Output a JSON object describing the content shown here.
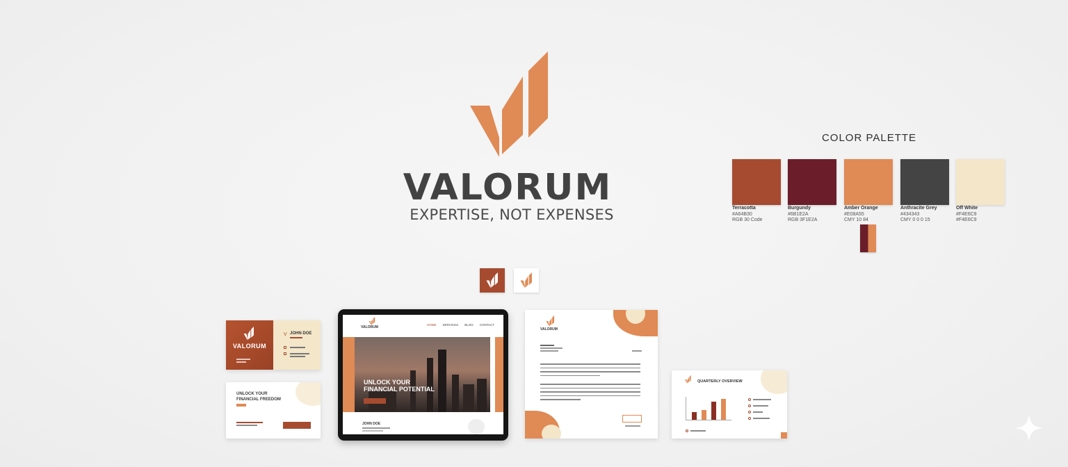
{
  "brand": {
    "name": "VALORUM",
    "tagline": "EXPERTISE, NOT EXPENSES"
  },
  "palette": {
    "title": "COLOR PALETTE",
    "swatches": [
      {
        "name": "Terracotta",
        "code1": "#A64B30",
        "code2": "RGB 30 Code",
        "color": "#a64b30"
      },
      {
        "name": "Burgundy",
        "code1": "#6B1E2A",
        "code2": "RGB 3F1E2A",
        "color": "#6b1e2a"
      },
      {
        "name": "Amber Orange",
        "code1": "#E08A55",
        "code2": "CMY 10 84",
        "color": "#e08a55"
      },
      {
        "name": "Anthracite Grey",
        "code1": "#434343",
        "code2": "CMY 0 0 0 15",
        "color": "#444444"
      },
      {
        "name": "Off White",
        "code1": "#F4E6C9",
        "code2": "#F4E6C9",
        "color": "#f4e6c9"
      }
    ]
  },
  "colors": {
    "terracotta": "#a64b30",
    "burgundy": "#6b1e2a",
    "orange": "#e08a55",
    "grey": "#444444",
    "cream": "#f4e6c9",
    "logo_orange": "#e08a55"
  },
  "icons": [
    "logo-mark-icon"
  ],
  "business_card": {
    "front_brand": "VALORUM",
    "person_name": "JOHN DOE",
    "back_headline_1": "UNLOCK YOUR",
    "back_headline_2": "FINANCIAL FREEDOM"
  },
  "website": {
    "logo": "VALORUM",
    "nav": [
      "HOME",
      "SERVICES",
      "BLOG",
      "CONTACT"
    ],
    "hero_line_1": "UNLOCK YOUR",
    "hero_line_2": "FINANCIAL POTENTIAL",
    "section_heading": "JOHN DOE"
  },
  "letterhead": {
    "logo": "VALORUM"
  },
  "report": {
    "title": "QUARTERLY OVERVIEW",
    "bars": [
      0.35,
      0.45,
      0.85,
      1.0
    ]
  }
}
